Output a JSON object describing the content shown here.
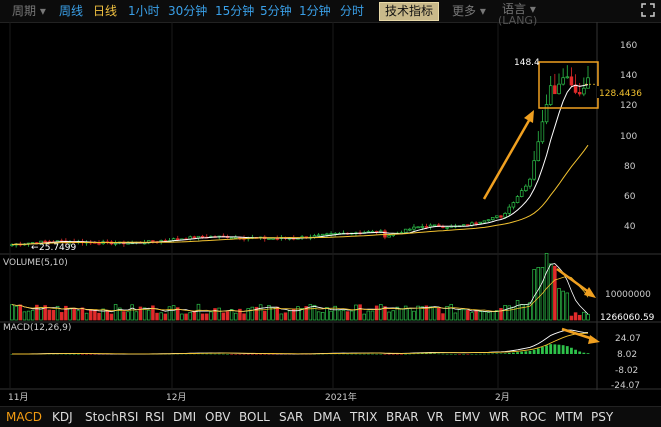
{
  "toolbar": {
    "period_label": "周期",
    "week_label": "周线",
    "day_label": "日线",
    "hour1_label": "1小时",
    "min30_label": "30分钟",
    "min15_label": "15分钟",
    "min5_label": "5分钟",
    "min1_label": "1分钟",
    "tick_label": "分时",
    "indicators_label": "技术指标",
    "more_label": "更多",
    "lang_label": "语言",
    "lang_sub": "(LANG)"
  },
  "price_panel": {
    "high_label": "148.4",
    "low_label": "25.7499",
    "current_label": "128.4436",
    "y_ticks": [
      "160",
      "140",
      "120",
      "100",
      "80",
      "60",
      "40"
    ]
  },
  "volume_panel": {
    "title": "VOLUME(5,10)",
    "y_ticks": [
      "10000000"
    ],
    "current_label": "1266060.59"
  },
  "macd_panel": {
    "title": "MACD(12,26,9)",
    "y_ticks": [
      "24.07",
      "8.02",
      "-8.02",
      "-24.07"
    ]
  },
  "x_axis": [
    "11月",
    "12月",
    "2021年",
    "2月"
  ],
  "indicators": [
    "MACD",
    "KDJ",
    "StochRSI",
    "RSI",
    "DMI",
    "OBV",
    "BOLL",
    "SAR",
    "DMA",
    "TRIX",
    "BRAR",
    "VR",
    "EMV",
    "WR",
    "ROC",
    "MTM",
    "PSY"
  ],
  "colors": {
    "up": "#2ec24a",
    "down": "#e02b2b",
    "ma_short": "#ffffff",
    "ma_long": "#f2c230",
    "highlight": "#f0a020",
    "toolbar_link": "#3aa0e8"
  },
  "chart_data": {
    "type": "candlestick",
    "x_labels": [
      "11月",
      "12月",
      "2021年",
      "2月"
    ],
    "price_range": [
      25.7499,
      148.4
    ],
    "current_price": 128.4436,
    "ylim": [
      20,
      165
    ],
    "volume_ylim": [
      0,
      16000000
    ],
    "macd_ylim": [
      -30,
      30
    ],
    "series": [
      {
        "name": "VOLUME(5,10)",
        "values": [
          1266060.59
        ]
      },
      {
        "name": "MACD(12,26,9)"
      }
    ]
  }
}
